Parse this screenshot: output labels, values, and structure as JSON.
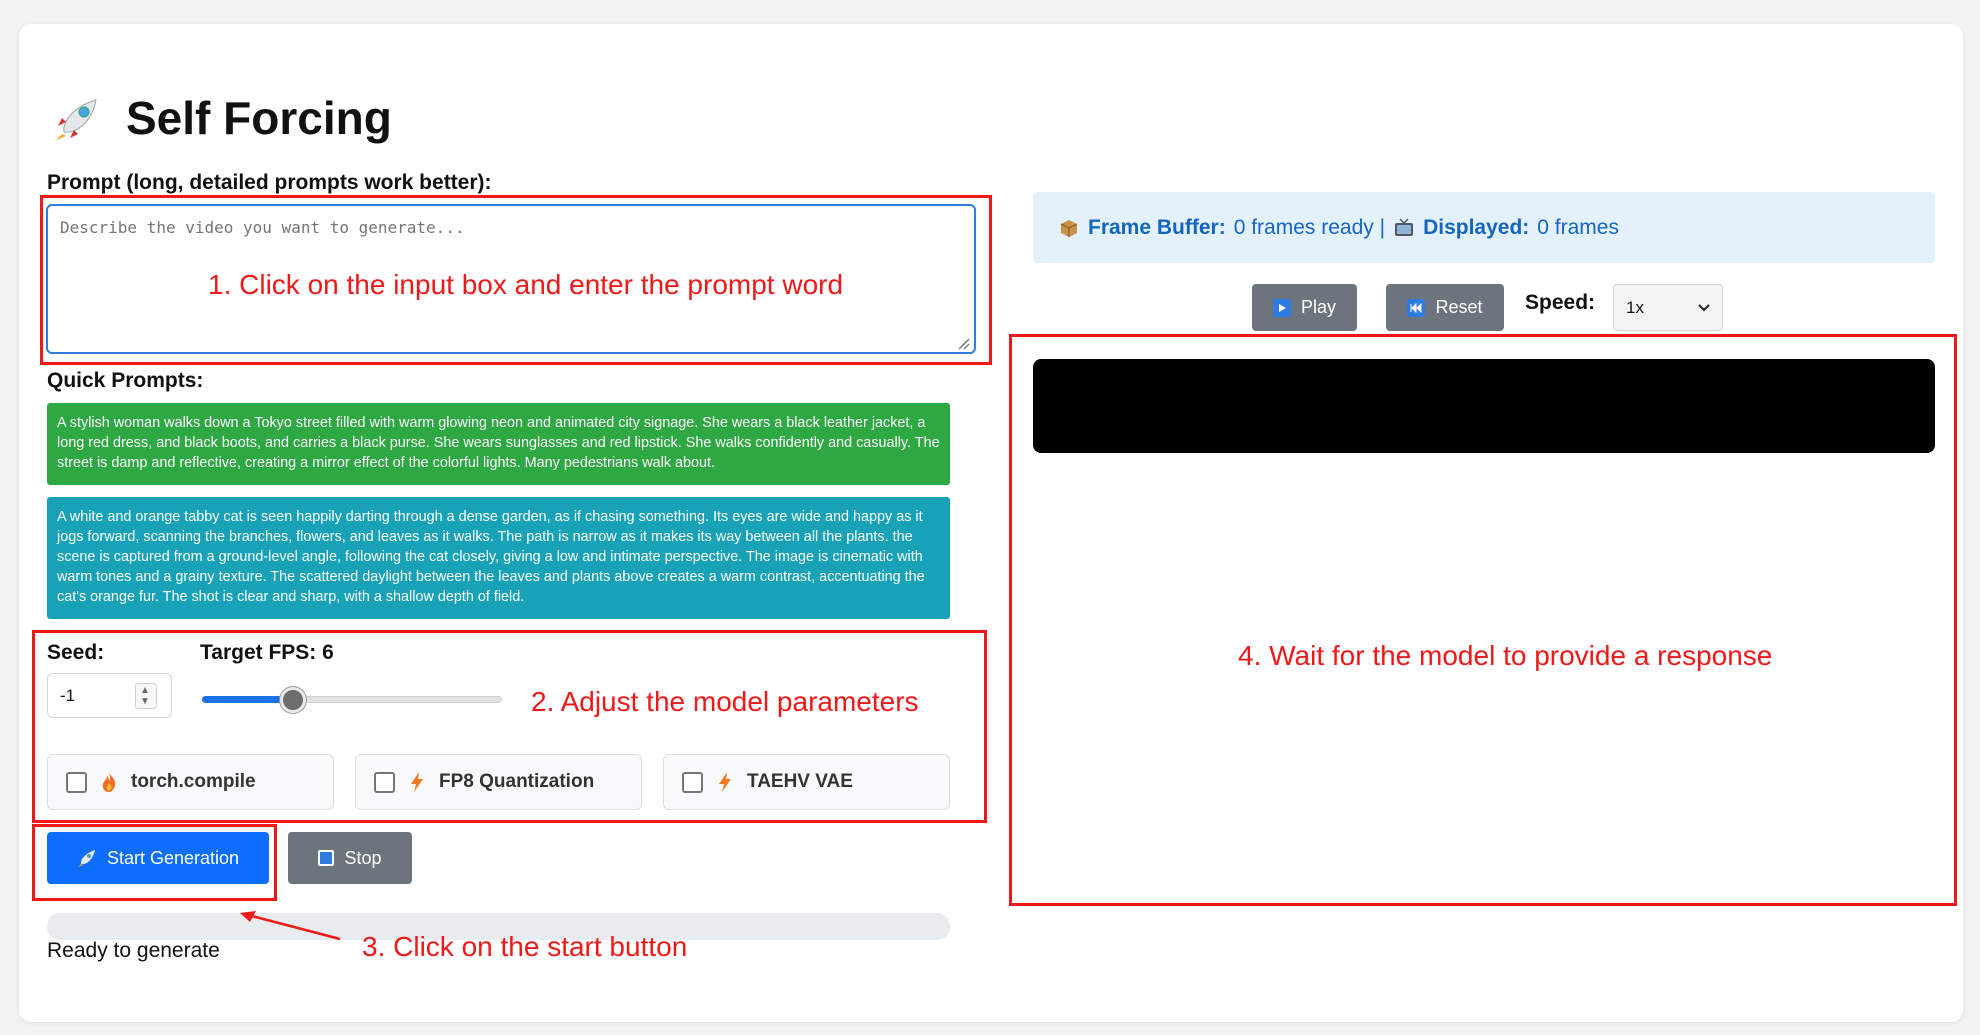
{
  "app": {
    "title": "Self Forcing"
  },
  "prompt": {
    "label": "Prompt (long, detailed prompts work better):",
    "placeholder": "Describe the video you want to generate...",
    "value": ""
  },
  "quick_prompts": {
    "label": "Quick Prompts:",
    "items": [
      {
        "text": "A stylish woman walks down a Tokyo street filled with warm glowing neon and animated city signage. She wears a black leather jacket, a long red dress, and black boots, and carries a black purse. She wears sunglasses and red lipstick. She walks confidently and casually. The street is damp and reflective, creating a mirror effect of the colorful lights. Many pedestrians walk about.",
        "color": "#2ea843"
      },
      {
        "text": "A white and orange tabby cat is seen happily darting through a dense garden, as if chasing something. Its eyes are wide and happy as it jogs forward, scanning the branches, flowers, and leaves as it walks. The path is narrow as it makes its way between all the plants. the scene is captured from a ground-level angle, following the cat closely, giving a low and intimate perspective. The image is cinematic with warm tones and a grainy texture. The scattered daylight between the leaves and plants above creates a warm contrast, accentuating the cat's orange fur. The shot is clear and sharp, with a shallow depth of field.",
        "color": "#17a2b8"
      }
    ]
  },
  "params": {
    "seed_label": "Seed:",
    "seed_value": "-1",
    "fps_label": "Target FPS: 6",
    "fps_value": 6,
    "fps_slider_fraction": 0.28,
    "options": [
      {
        "label": "torch.compile",
        "icon": "fire-icon",
        "checked": false
      },
      {
        "label": "FP8 Quantization",
        "icon": "lightning-icon",
        "checked": false
      },
      {
        "label": "TAEHV VAE",
        "icon": "lightning-icon",
        "checked": false
      }
    ]
  },
  "actions": {
    "start_label": "Start Generation",
    "stop_label": "Stop"
  },
  "status": {
    "text": "Ready to generate",
    "progress": 0
  },
  "buffer": {
    "frame_buffer_label": "Frame Buffer:",
    "frame_buffer_value": "0 frames ready |",
    "displayed_label": "Displayed:",
    "displayed_value": "0 frames"
  },
  "playback": {
    "play_label": "Play",
    "reset_label": "Reset",
    "speed_label": "Speed:",
    "speed_value": "1x"
  },
  "annotations": {
    "step1": "1. Click on the input box and enter the prompt word",
    "step2": "2. Adjust the model parameters",
    "step3": "3. Click on the start button",
    "step4": "4. Wait for the model to provide a response",
    "color": "#f01818"
  }
}
